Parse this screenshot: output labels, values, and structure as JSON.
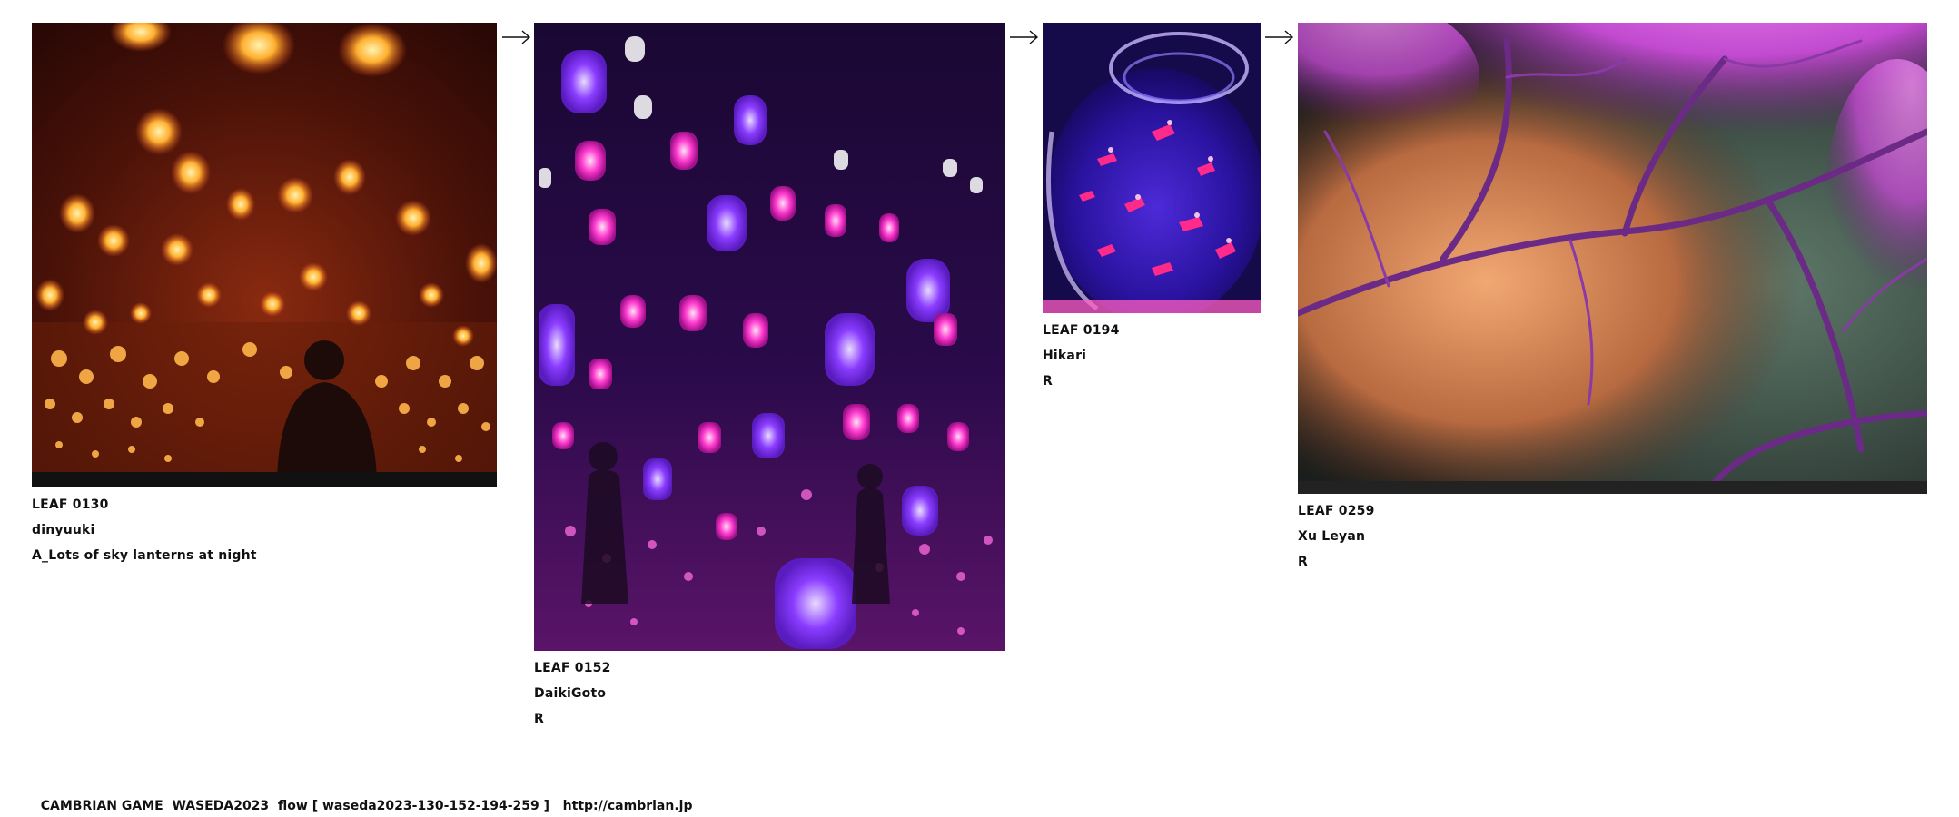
{
  "flow": {
    "leaves": [
      {
        "id": "LEAF 0130",
        "author": "dinyuuki",
        "note": "A_Lots of sky lanterns at night",
        "image": "sky-lanterns-photo"
      },
      {
        "id": "LEAF 0152",
        "author": "DaikiGoto",
        "note": "R",
        "image": "glowing-lamps-installation-photo"
      },
      {
        "id": "LEAF 0194",
        "author": "Hikari",
        "note": "R",
        "image": "goldfish-bowl-photo"
      },
      {
        "id": "LEAF 0259",
        "author": "Xu Leyan",
        "note": "R",
        "image": "night-cherry-blossom-photo"
      }
    ],
    "arrow_icon": "arrow-right-icon"
  },
  "footer": {
    "text": "CAMBRIAN GAME  WASEDA2023  flow [ waseda2023-130-152-194-259 ]   ",
    "url": "http://cambrian.jp"
  },
  "colors": {
    "background": "#ffffff",
    "text": "#111111",
    "lantern_glow": "#ffb030",
    "lamp_purple": "#8a3cff",
    "lamp_pink": "#ff3ccf",
    "blossom_pink": "#d65ce0"
  }
}
